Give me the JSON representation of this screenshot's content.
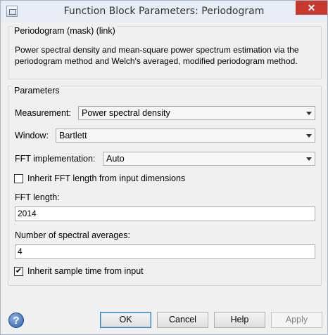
{
  "window": {
    "title": "Function Block Parameters: Periodogram",
    "close_symbol": "✕",
    "icon": "simulink-block-icon"
  },
  "description": {
    "group_title": "Periodogram (mask) (link)",
    "text": "Power spectral density and mean-square power spectrum estimation via the periodogram method and Welch's averaged, modified periodogram method."
  },
  "parameters": {
    "group_title": "Parameters",
    "measurement": {
      "label": "Measurement:",
      "value": "Power spectral density"
    },
    "window": {
      "label": "Window:",
      "value": "Bartlett"
    },
    "fft_implementation": {
      "label": "FFT implementation:",
      "value": "Auto"
    },
    "inherit_fft_length": {
      "label": "Inherit FFT length from input dimensions",
      "checked": false,
      "mark": ""
    },
    "fft_length": {
      "label": "FFT length:",
      "value": "2014"
    },
    "spectral_averages": {
      "label": "Number of spectral averages:",
      "value": "4"
    },
    "inherit_sample_time": {
      "label": "Inherit sample time from input",
      "checked": true,
      "mark": "✔"
    }
  },
  "buttons": {
    "help_icon": "?",
    "ok": "OK",
    "cancel": "Cancel",
    "help": "Help",
    "apply": "Apply"
  }
}
